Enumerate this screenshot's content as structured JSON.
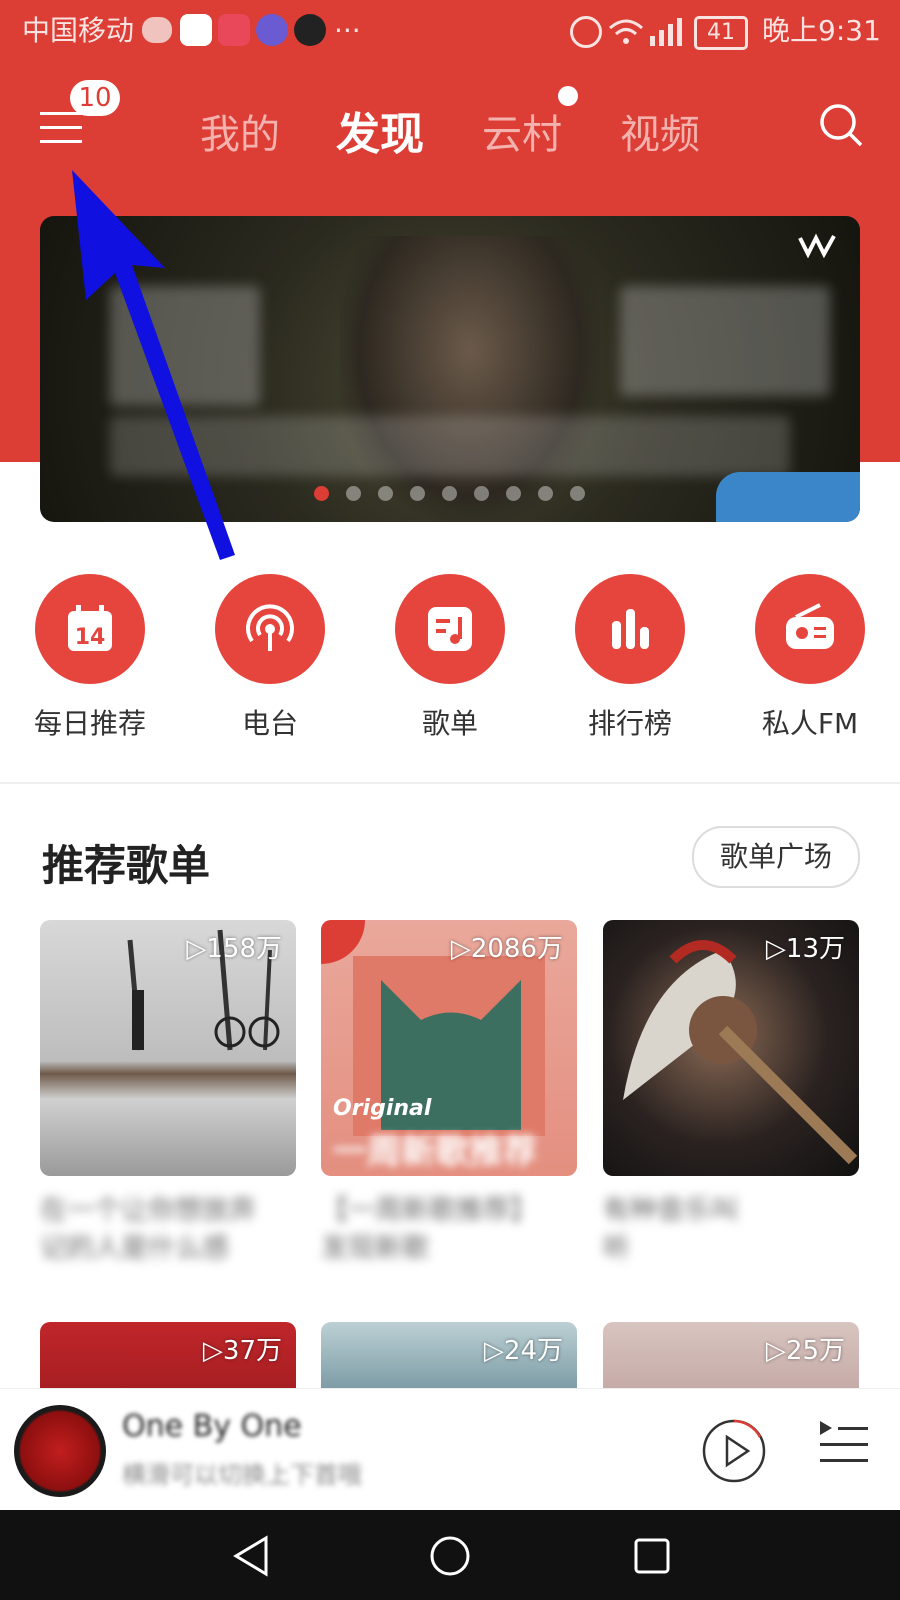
{
  "status_bar": {
    "carrier": "中国移动",
    "battery": "41",
    "time": "晚上9:31",
    "more": "···"
  },
  "header": {
    "menu_badge": "10",
    "tabs": [
      {
        "label": "我的"
      },
      {
        "label": "发现"
      },
      {
        "label": "云村"
      },
      {
        "label": "视频"
      }
    ]
  },
  "categories": [
    {
      "label": "每日推荐",
      "icon": "calendar-icon",
      "day": "14"
    },
    {
      "label": "电台",
      "icon": "radio-podcast-icon"
    },
    {
      "label": "歌单",
      "icon": "playlist-icon"
    },
    {
      "label": "排行榜",
      "icon": "chart-icon"
    },
    {
      "label": "私人FM",
      "icon": "fm-radio-icon"
    }
  ],
  "playlists": {
    "title": "推荐歌单",
    "more_label": "歌单广场",
    "cards": [
      {
        "count": "▷158万",
        "caption_line1": "在一个让你想放弃",
        "caption_line2": "记的人是什么感"
      },
      {
        "count": "▷2086万",
        "caption_line1": "【一周新歌推荐】",
        "caption_line2": "发现新歌",
        "overlay_tag": "Original",
        "overlay_title": "一周新歌推荐"
      },
      {
        "count": "▷13万",
        "caption_line1": "有种音乐叫",
        "caption_line2": "听"
      },
      {
        "count": "▷37万"
      },
      {
        "count": "▷24万"
      },
      {
        "count": "▷25万"
      }
    ]
  },
  "player": {
    "song_title": "One By One",
    "subtitle": "横滑可以切换上下首哦"
  },
  "colors": {
    "brand_red": "#dc3d35",
    "icon_red": "#e6453d"
  }
}
